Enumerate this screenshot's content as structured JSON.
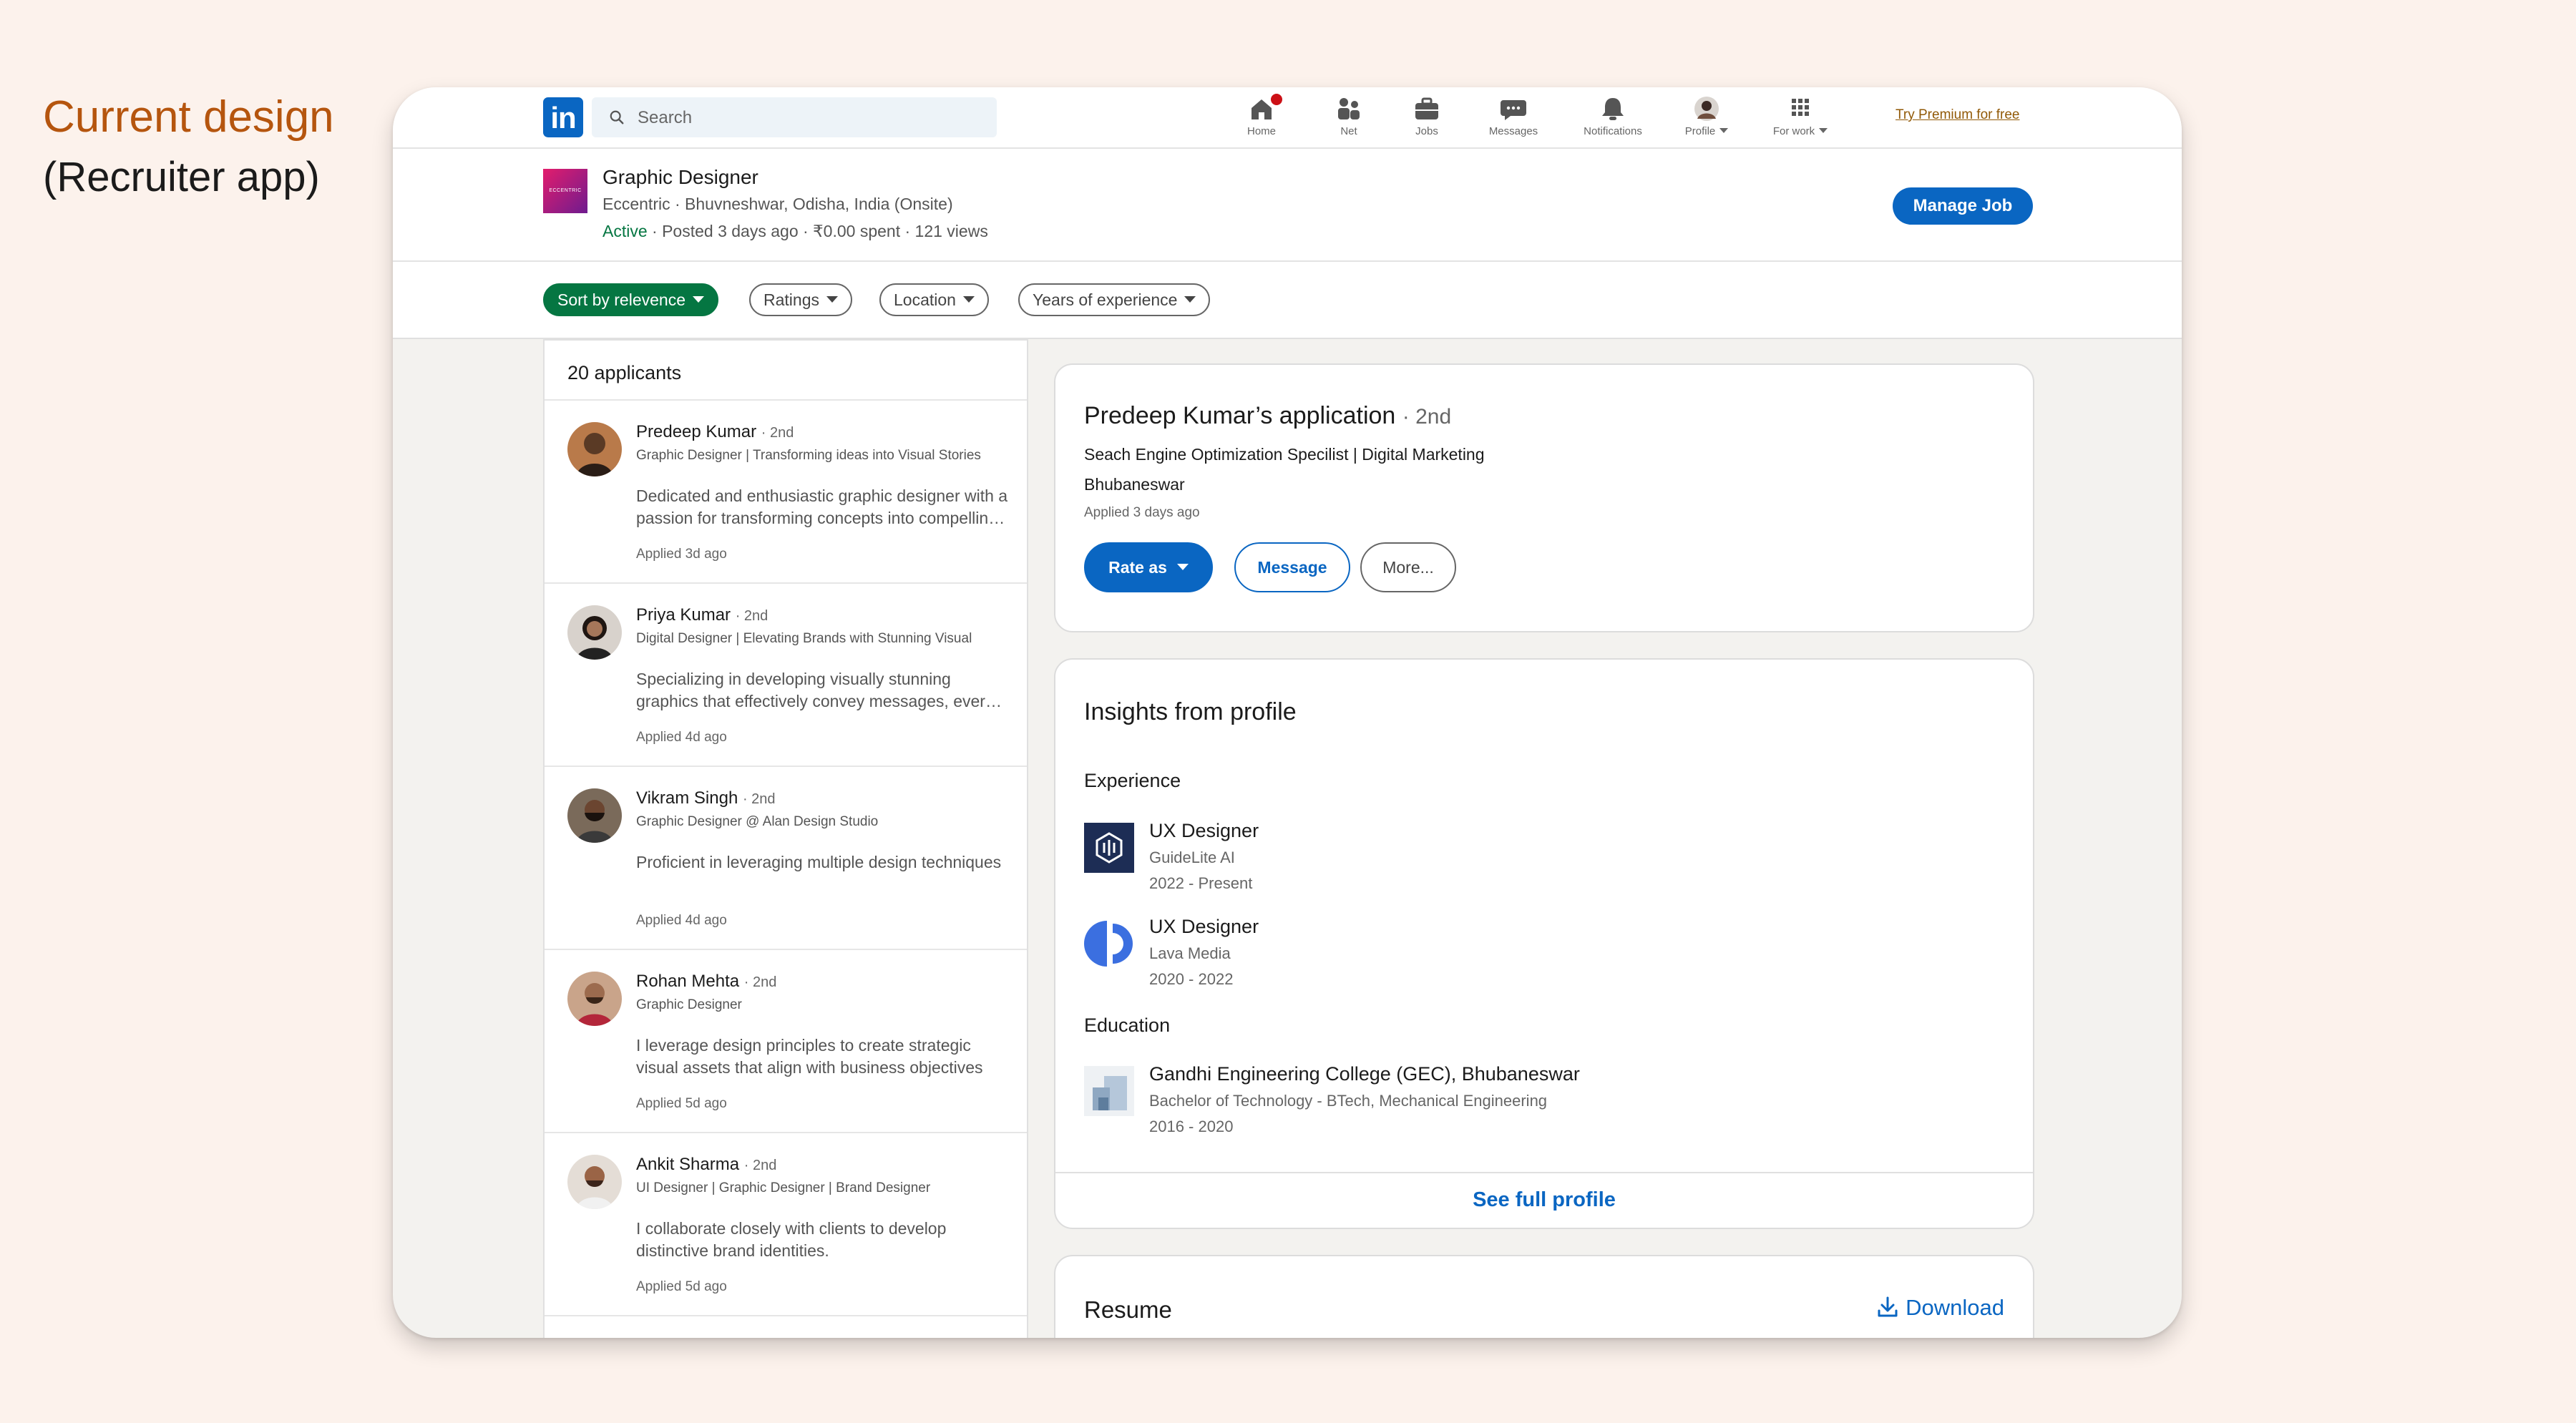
{
  "caption": {
    "title": "Current design",
    "subtitle": "(Recruiter app)"
  },
  "nav": {
    "logo": "in",
    "search_placeholder": "Search",
    "items": [
      {
        "label": "Home",
        "icon": "home-icon"
      },
      {
        "label": "Net",
        "icon": "network-icon"
      },
      {
        "label": "Jobs",
        "icon": "briefcase-icon"
      },
      {
        "label": "Messages",
        "icon": "chat-icon"
      },
      {
        "label": "Notifications",
        "icon": "bell-icon"
      },
      {
        "label": "Profile",
        "icon": "avatar"
      },
      {
        "label": "For work",
        "icon": "grid-icon"
      }
    ],
    "premium": "Try Premium for free"
  },
  "job": {
    "logo_text": "ECCENTRIC",
    "title": "Graphic Designer",
    "meta": "Eccentric · Bhuvneshwar, Odisha, India (Onsite)",
    "status": "Active",
    "status_rest": " · Posted 3 days ago · ₹0.00 spent · 121 views",
    "manage": "Manage Job"
  },
  "filters": [
    "Sort by relevence",
    "Ratings",
    "Location",
    "Years of experience"
  ],
  "applicants": {
    "count_label": "20 applicants",
    "items": [
      {
        "name": "Predeep Kumar",
        "degree": "· 2nd",
        "headline": "Graphic Designer | Transforming ideas into Visual Stories",
        "summary": "Dedicated and enthusiastic graphic designer with a passion for transforming concepts into compelling visuals",
        "time": "Applied 3d ago"
      },
      {
        "name": "Priya Kumar",
        "degree": "· 2nd",
        "headline": "Digital Designer | Elevating Brands with Stunning Visual",
        "summary": "Specializing in developing visually stunning graphics that effectively convey messages, every time",
        "time": "Applied 4d ago"
      },
      {
        "name": "Vikram Singh",
        "degree": "· 2nd",
        "headline": "Graphic Designer @ Alan Design Studio",
        "summary": "Proficient in leveraging multiple design techniques",
        "time": "Applied 4d ago"
      },
      {
        "name": "Rohan Mehta",
        "degree": "· 2nd",
        "headline": "Graphic Designer",
        "summary": "I leverage design principles to create strategic visual assets that align with business objectives",
        "time": "Applied 5d ago"
      },
      {
        "name": "Ankit Sharma",
        "degree": "· 2nd",
        "headline": "UI Designer | Graphic Designer | Brand Designer",
        "summary": "I collaborate closely with clients to develop distinctive brand identities.",
        "time": "Applied 5d ago"
      }
    ]
  },
  "application": {
    "title": "Predeep Kumar’s application",
    "degree": "· 2nd",
    "headline": "Seach Engine Optimization Specilist | Digital Marketing",
    "location": "Bhubaneswar",
    "applied": "Applied 3 days ago",
    "rate": "Rate as",
    "message": "Message",
    "more": "More..."
  },
  "insights": {
    "title": "Insights from profile",
    "experience_label": "Experience",
    "experience": [
      {
        "title": "UX Designer",
        "company": "GuideLite AI",
        "years": "2022 - Present"
      },
      {
        "title": "UX Designer",
        "company": "Lava Media",
        "years": "2020 - 2022"
      }
    ],
    "education_label": "Education",
    "education": {
      "school": "Gandhi Engineering College (GEC), Bhubaneswar",
      "degree": "Bachelor of Technology - BTech, Mechanical Engineering",
      "years": "2016 - 2020"
    },
    "see_full": "See full profile"
  },
  "resume": {
    "title": "Resume",
    "download": "Download"
  },
  "colors": {
    "brand_blue": "#0a66c2",
    "green": "#057642",
    "caption_orange": "#b5550e",
    "page_bg": "#fcf2ec"
  }
}
